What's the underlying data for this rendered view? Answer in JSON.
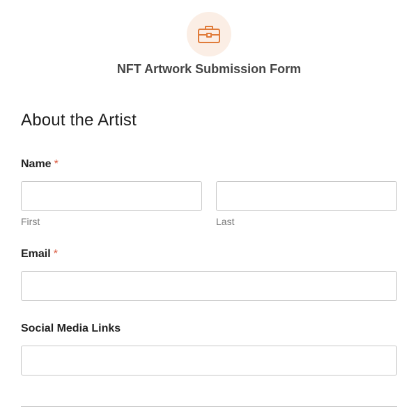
{
  "header": {
    "icon": "briefcase-icon",
    "title": "NFT Artwork Submission Form"
  },
  "section": {
    "heading": "About the Artist"
  },
  "fields": {
    "name": {
      "label": "Name",
      "required_marker": "*",
      "first_value": "",
      "last_value": "",
      "first_sublabel": "First",
      "last_sublabel": "Last"
    },
    "email": {
      "label": "Email",
      "required_marker": "*",
      "value": ""
    },
    "social": {
      "label": "Social Media Links",
      "value": ""
    }
  },
  "colors": {
    "accent": "#e07b39",
    "icon_background": "#fbeee5",
    "required": "#d9573d"
  }
}
